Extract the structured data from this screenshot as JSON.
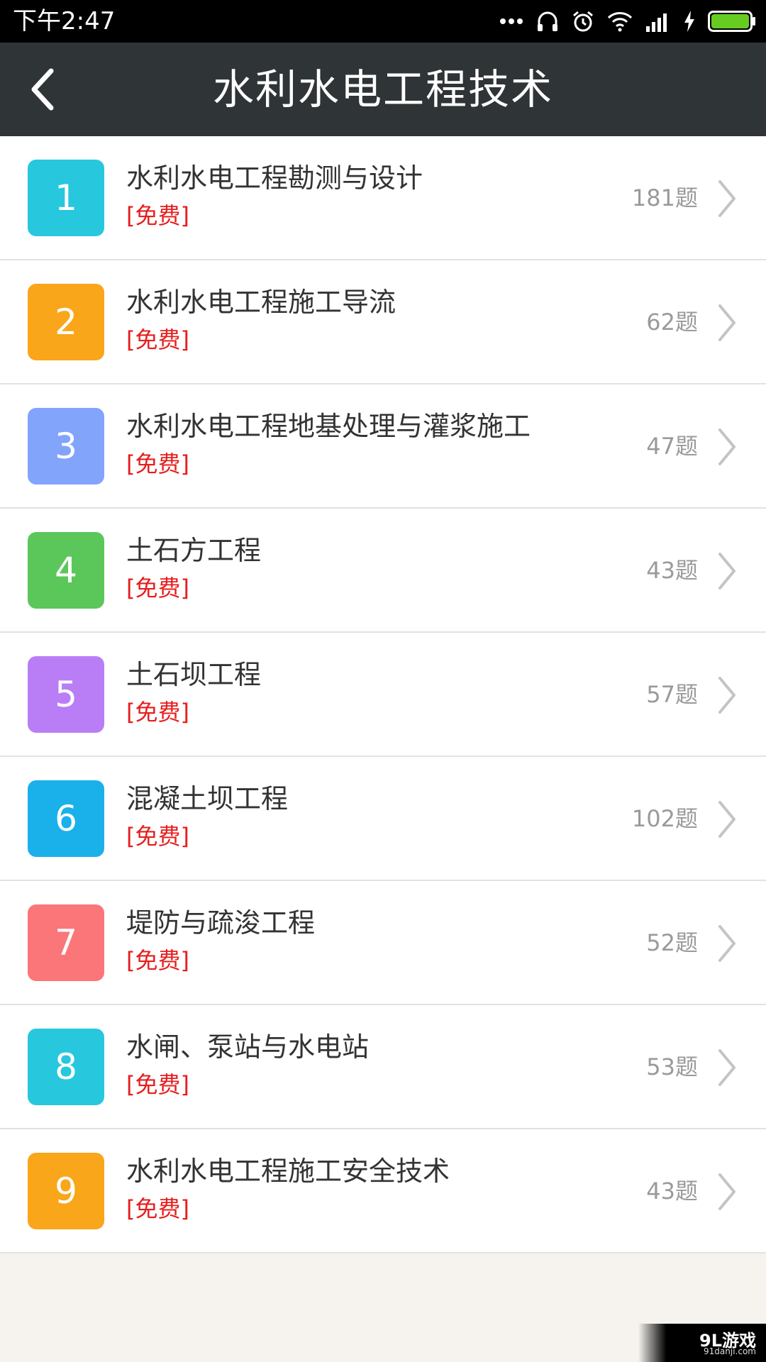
{
  "status_bar": {
    "time": "下午2:47",
    "icons": [
      "more-dots-icon",
      "headset-icon",
      "alarm-icon",
      "wifi-icon",
      "signal-icon",
      "charging-icon",
      "battery-icon"
    ],
    "battery_color": "#66cc22"
  },
  "header": {
    "title": "水利水电工程技术",
    "back_icon": "chevron-left-icon"
  },
  "items": [
    {
      "number": "1",
      "title": "水利水电工程勘测与设计",
      "tag": "[免费]",
      "count": "181题",
      "color": "#27c7de"
    },
    {
      "number": "2",
      "title": "水利水电工程施工导流",
      "tag": "[免费]",
      "count": "62题",
      "color": "#f9a61a"
    },
    {
      "number": "3",
      "title": "水利水电工程地基处理与灌浆施工",
      "tag": "[免费]",
      "count": "47题",
      "color": "#82a4fb"
    },
    {
      "number": "4",
      "title": "土石方工程",
      "tag": "[免费]",
      "count": "43题",
      "color": "#5bc75b"
    },
    {
      "number": "5",
      "title": "土石坝工程",
      "tag": "[免费]",
      "count": "57题",
      "color": "#b97ef6"
    },
    {
      "number": "6",
      "title": "混凝土坝工程",
      "tag": "[免费]",
      "count": "102题",
      "color": "#1ab0ea"
    },
    {
      "number": "7",
      "title": "堤防与疏浚工程",
      "tag": "[免费]",
      "count": "52题",
      "color": "#fb7679"
    },
    {
      "number": "8",
      "title": "水闸、泵站与水电站",
      "tag": "[免费]",
      "count": "53题",
      "color": "#27c7de"
    },
    {
      "number": "9",
      "title": "水利水电工程施工安全技术",
      "tag": "[免费]",
      "count": "43题",
      "color": "#f9a61a"
    }
  ],
  "watermark": {
    "logo": "9L游戏",
    "site": "91danji.com"
  }
}
